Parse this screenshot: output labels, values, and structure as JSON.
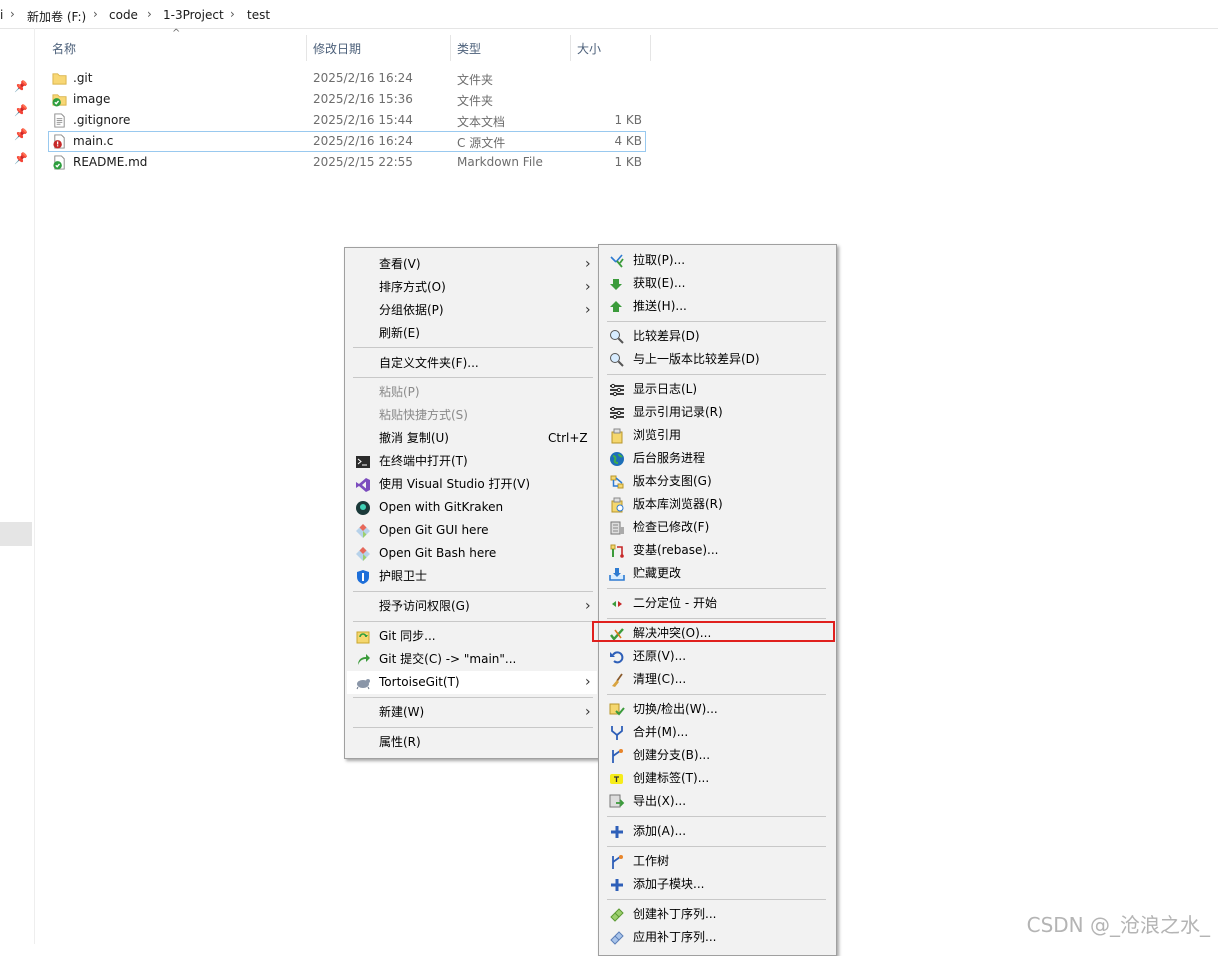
{
  "address_bar": {
    "segments": [
      "新加卷 (F:)",
      "code",
      "1-3Project",
      "test"
    ]
  },
  "columns": {
    "name": "名称",
    "modified": "修改日期",
    "type": "类型",
    "size": "大小"
  },
  "files": [
    {
      "name": ".git",
      "modified": "2025/2/16 16:24",
      "type": "文件夹",
      "size": "",
      "icon": "folder-icon"
    },
    {
      "name": "image",
      "modified": "2025/2/16 15:36",
      "type": "文件夹",
      "size": "",
      "icon": "folder-git-ok-icon"
    },
    {
      "name": ".gitignore",
      "modified": "2025/2/16 15:44",
      "type": "文本文档",
      "size": "1 KB",
      "icon": "text-file-icon"
    },
    {
      "name": "main.c",
      "modified": "2025/2/16 16:24",
      "type": "C 源文件",
      "size": "4 KB",
      "icon": "file-conflict-icon"
    },
    {
      "name": "README.md",
      "modified": "2025/2/15 22:55",
      "type": "Markdown File",
      "size": "1 KB",
      "icon": "file-git-ok-icon"
    }
  ],
  "context_menu": {
    "items": [
      {
        "label": "查看(V)"
      },
      {
        "label": "排序方式(O)"
      },
      {
        "label": "分组依据(P)"
      },
      {
        "label": "刷新(E)"
      },
      {
        "label": "自定义文件夹(F)..."
      },
      {
        "label": "粘贴(P)"
      },
      {
        "label": "粘贴快捷方式(S)"
      },
      {
        "label": "撤消 复制(U)",
        "shortcut": "Ctrl+Z"
      },
      {
        "label": "在终端中打开(T)"
      },
      {
        "label": "使用 Visual Studio 打开(V)"
      },
      {
        "label": "Open with GitKraken"
      },
      {
        "label": "Open Git GUI here"
      },
      {
        "label": "Open Git Bash here"
      },
      {
        "label": "护眼卫士"
      },
      {
        "label": "授予访问权限(G)"
      },
      {
        "label": "Git 同步..."
      },
      {
        "label": "Git 提交(C) -> \"main\"..."
      },
      {
        "label": "TortoiseGit(T)"
      },
      {
        "label": "新建(W)"
      },
      {
        "label": "属性(R)"
      }
    ]
  },
  "tortoise_menu": {
    "items": [
      {
        "label": "拉取(P)..."
      },
      {
        "label": "获取(E)..."
      },
      {
        "label": "推送(H)..."
      },
      {
        "label": "比较差异(D)"
      },
      {
        "label": "与上一版本比较差异(D)"
      },
      {
        "label": "显示日志(L)"
      },
      {
        "label": "显示引用记录(R)"
      },
      {
        "label": "浏览引用"
      },
      {
        "label": "后台服务进程"
      },
      {
        "label": "版本分支图(G)"
      },
      {
        "label": "版本库浏览器(R)"
      },
      {
        "label": "检查已修改(F)"
      },
      {
        "label": "变基(rebase)..."
      },
      {
        "label": "贮藏更改"
      },
      {
        "label": "二分定位 - 开始"
      },
      {
        "label": "解决冲突(O)..."
      },
      {
        "label": "还原(V)..."
      },
      {
        "label": "清理(C)..."
      },
      {
        "label": "切换/检出(W)..."
      },
      {
        "label": "合并(M)..."
      },
      {
        "label": "创建分支(B)..."
      },
      {
        "label": "创建标签(T)..."
      },
      {
        "label": "导出(X)..."
      },
      {
        "label": "添加(A)..."
      },
      {
        "label": "工作树"
      },
      {
        "label": "添加子模块..."
      },
      {
        "label": "创建补丁序列..."
      },
      {
        "label": "应用补丁序列..."
      }
    ]
  },
  "watermark": "CSDN @_沧浪之水_",
  "colors": {
    "highlight_box": "#e0201e",
    "selection_border": "#99c9ef",
    "header_text": "#4c607a"
  }
}
